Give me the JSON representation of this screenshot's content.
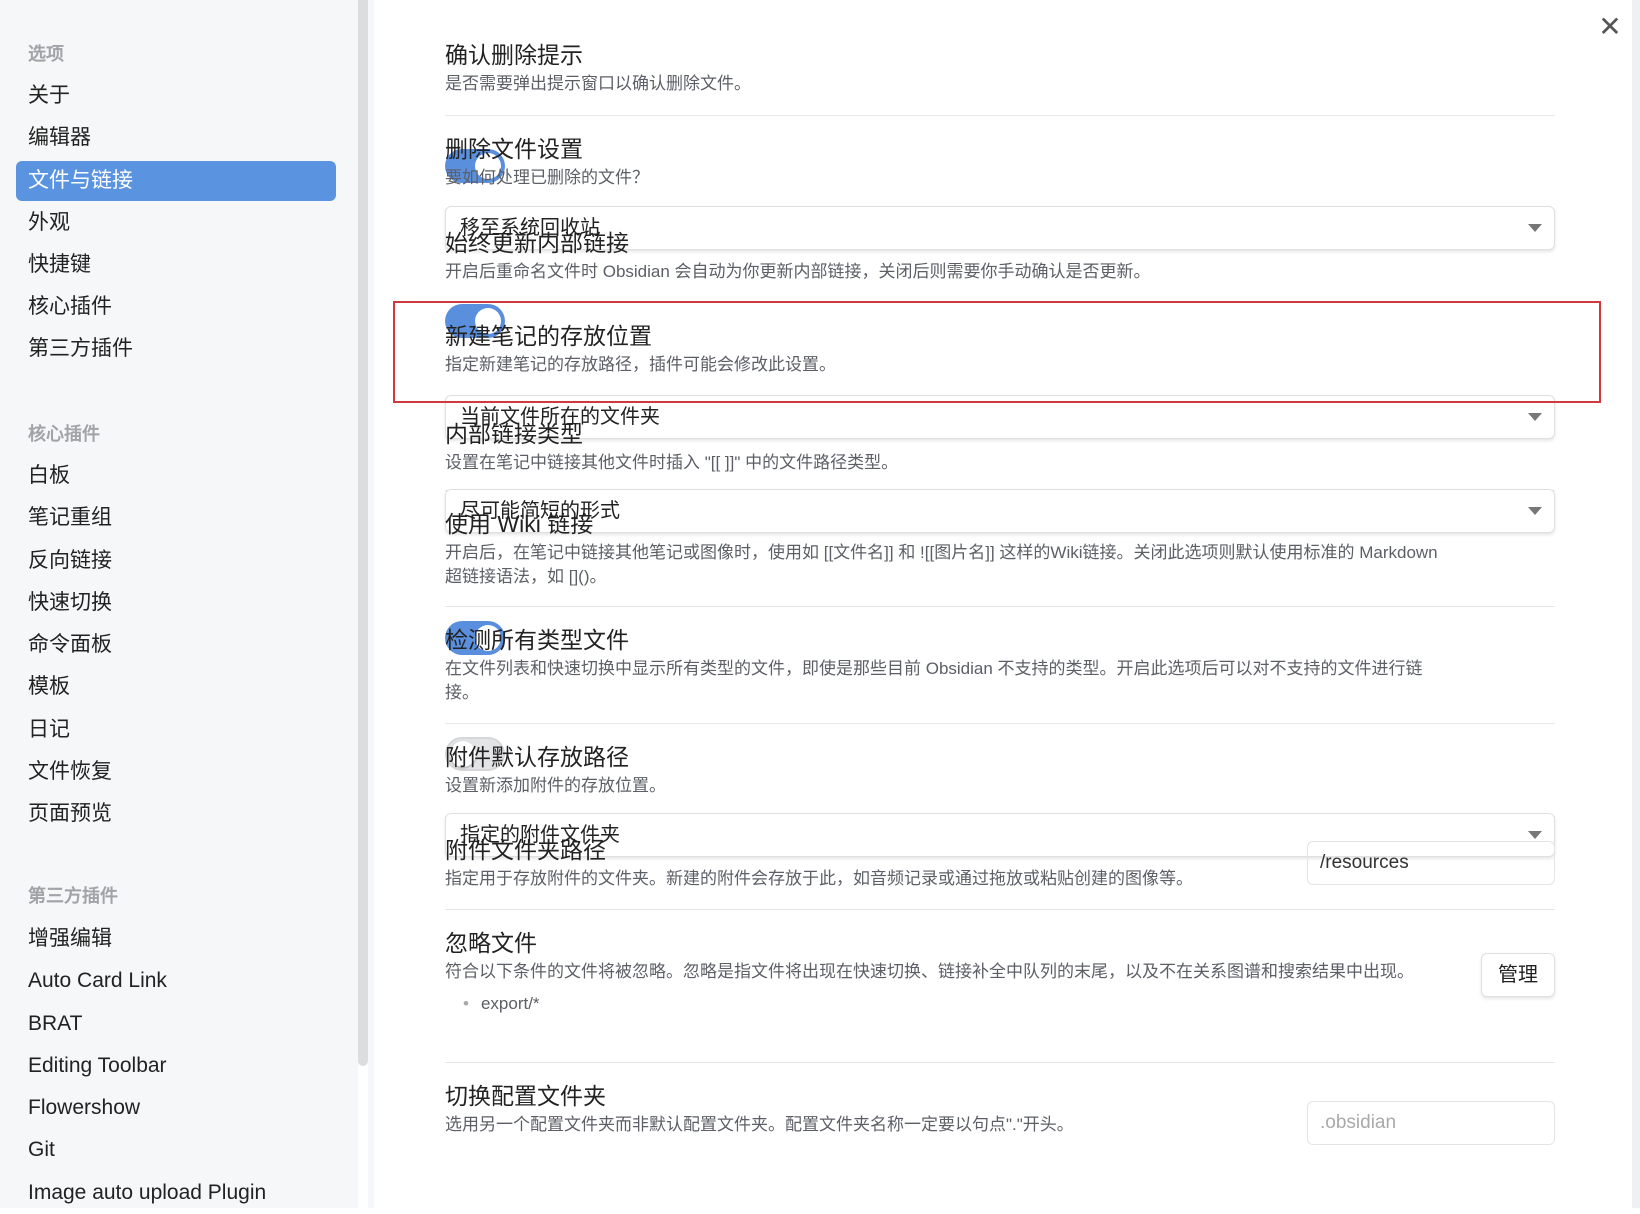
{
  "sidebar": {
    "sections": [
      {
        "header": "选项",
        "items": [
          "关于",
          "编辑器",
          "文件与链接",
          "外观",
          "快捷键",
          "核心插件",
          "第三方插件"
        ]
      },
      {
        "header": "核心插件",
        "items": [
          "白板",
          "笔记重组",
          "反向链接",
          "快速切换",
          "命令面板",
          "模板",
          "日记",
          "文件恢复",
          "页面预览"
        ]
      },
      {
        "header": "第三方插件",
        "items": [
          "增强编辑",
          "Auto Card Link",
          "BRAT",
          "Editing Toolbar",
          "Flowershow",
          "Git",
          "Image auto upload Plugin"
        ]
      }
    ],
    "active": "文件与链接"
  },
  "settings": [
    {
      "title": "确认删除提示",
      "desc": "是否需要弹出提示窗口以确认删除文件。",
      "toggle": true
    },
    {
      "title": "删除文件设置",
      "desc": "要如何处理已删除的文件？",
      "select": "移至系统回收站"
    },
    {
      "title": "始终更新内部链接",
      "desc": "开启后重命名文件时 Obsidian 会自动为你更新内部链接，关闭后则需要你手动确认是否更新。",
      "toggle": true
    },
    {
      "title": "新建笔记的存放位置",
      "desc": "指定新建笔记的存放路径，插件可能会修改此设置。",
      "select": "当前文件所在的文件夹"
    },
    {
      "title": "内部链接类型",
      "desc": "设置在笔记中链接其他文件时插入 \"[[ ]]\" 中的文件路径类型。",
      "select": "尽可能简短的形式"
    },
    {
      "title": "使用 Wiki 链接",
      "desc": "开启后，在笔记中链接其他笔记或图像时，使用如 [[文件名]] 和 ![[图片名]] 这样的Wiki链接。关闭此选项则默认使用标准的 Markdown 超链接语法，如 []()。",
      "toggle": true
    },
    {
      "title": "检测所有类型文件",
      "desc": "在文件列表和快速切换中显示所有类型的文件，即使是那些目前 Obsidian 不支持的类型。开启此选项后可以对不支持的文件进行链接。",
      "toggle": false
    },
    {
      "title": "附件默认存放路径",
      "desc": "设置新添加附件的存放位置。",
      "select": "指定的附件文件夹"
    },
    {
      "title": "附件文件夹路径",
      "desc": "指定用于存放附件的文件夹。新建的附件会存放于此，如音频记录或通过拖放或粘贴创建的图像等。",
      "input": "/resources"
    },
    {
      "title": "忽略文件",
      "desc": "符合以下条件的文件将被忽略。忽略是指文件将出现在快速切换、链接补全中队列的末尾，以及不在关系图谱和搜索结果中出现。",
      "button": "管理",
      "list": [
        "export/*"
      ]
    },
    {
      "title": "切换配置文件夹",
      "desc": "选用另一个配置文件夹而非默认配置文件夹。配置文件夹名称一定要以句点\".\"开头。",
      "placeholder": ".obsidian"
    }
  ],
  "close_icon": "close-icon",
  "colors": {
    "accent": "#5a93e0",
    "highlight": "#d03a3f"
  }
}
